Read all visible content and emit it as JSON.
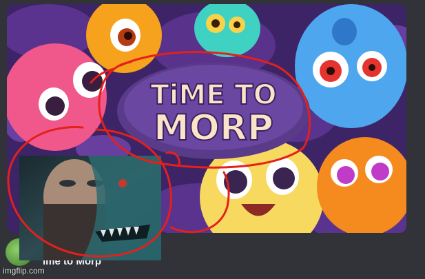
{
  "activity": {
    "logo_line1": "TiME TO",
    "logo_line2": "MORP",
    "name": "ime to Morp"
  },
  "watermark": "imgflip.com",
  "colors": {
    "background": "#313338",
    "logo_plaque": "#5a3b8a",
    "logo_text": "#fbe3c9",
    "annotation_red": "#e4201b",
    "foliage": "#4a2a7a"
  },
  "icons": [
    "avatar-icon"
  ]
}
